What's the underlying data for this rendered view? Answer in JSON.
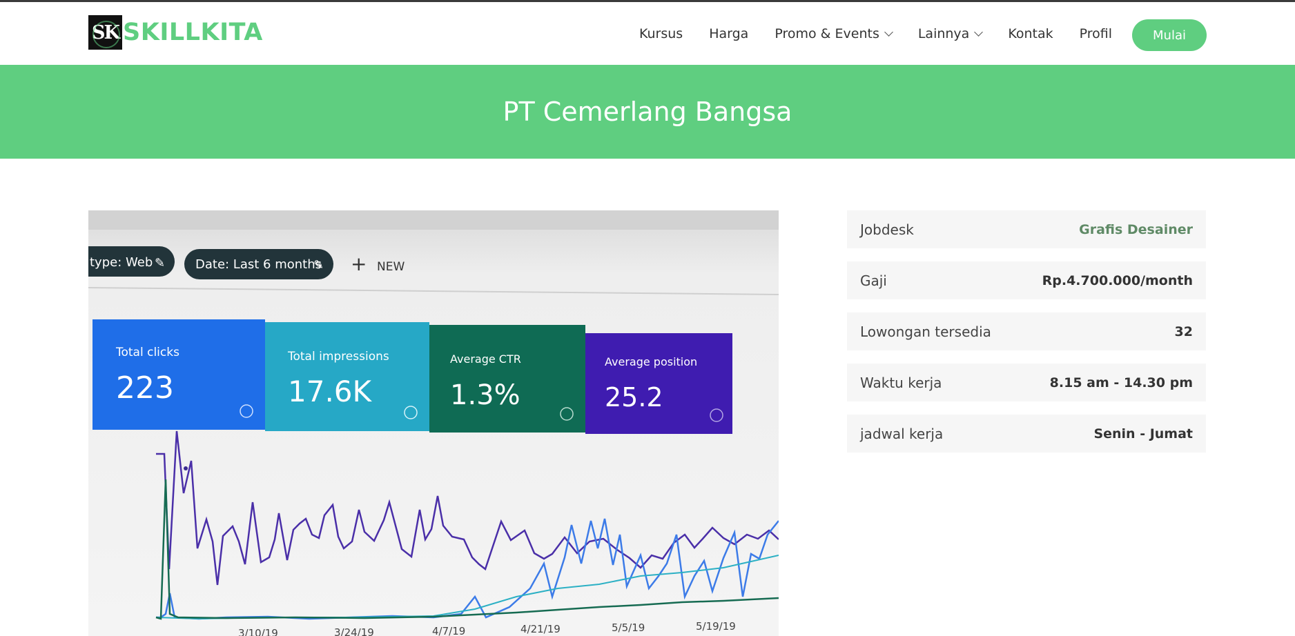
{
  "brand": {
    "logo_mark": "SK",
    "name": "SKILLKITA"
  },
  "nav": {
    "items": [
      {
        "label": "Kursus",
        "dropdown": false
      },
      {
        "label": "Harga",
        "dropdown": false
      },
      {
        "label": "Promo & Events",
        "dropdown": true
      },
      {
        "label": "Lainnya",
        "dropdown": true
      },
      {
        "label": "Kontak",
        "dropdown": false
      },
      {
        "label": "Profil",
        "dropdown": false
      }
    ],
    "cta_label": "Mulai"
  },
  "banner": {
    "title": "PT Cemerlang Bangsa"
  },
  "photo": {
    "filters": [
      "type: Web",
      "Date: Last 6 months"
    ],
    "new_label": "NEW",
    "metrics": [
      {
        "label": "Total clicks",
        "value": "223"
      },
      {
        "label": "Total impressions",
        "value": "17.6K"
      },
      {
        "label": "Average CTR",
        "value": "1.3%"
      },
      {
        "label": "Average position",
        "value": "25.2"
      }
    ],
    "x_dates": [
      "3/10/19",
      "3/24/19",
      "4/7/19",
      "4/21/19",
      "5/5/19",
      "5/19/19"
    ]
  },
  "job_info": [
    {
      "label": "Jobdesk",
      "value": "Grafis Desainer",
      "accent": true
    },
    {
      "label": "Gaji",
      "value": "Rp.4.700.000/month",
      "accent": false
    },
    {
      "label": "Lowongan tersedia",
      "value": "32",
      "accent": false
    },
    {
      "label": "Waktu kerja",
      "value": "8.15 am - 14.30 pm",
      "accent": false
    },
    {
      "label": "jadwal kerja",
      "value": "Senin - Jumat",
      "accent": false
    }
  ],
  "colors": {
    "brand_green": "#5fce80",
    "tile_blue": "#1f6ee8",
    "tile_teal": "#26a8c6",
    "tile_green": "#0f6b54",
    "tile_purple": "#3f1cb0"
  }
}
